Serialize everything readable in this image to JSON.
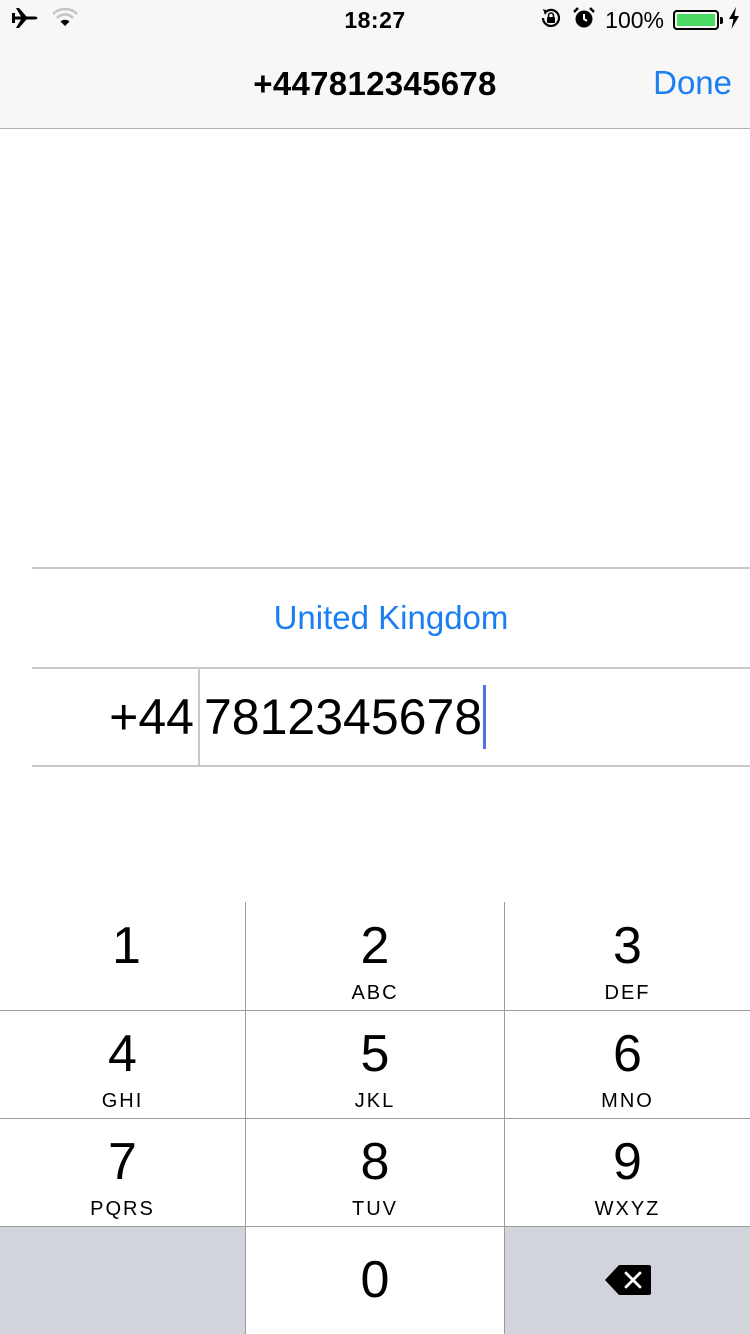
{
  "status_bar": {
    "time": "18:27",
    "battery_percent": "100%",
    "icons": [
      "airplane-icon",
      "wifi-icon",
      "rotation-lock-icon",
      "alarm-icon",
      "battery-icon",
      "charging-icon"
    ]
  },
  "nav": {
    "title": "+447812345678",
    "done_label": "Done"
  },
  "form": {
    "country": "United Kingdom",
    "dial_code": "+44",
    "phone_number": "7812345678"
  },
  "keypad": {
    "keys": [
      {
        "num": "1",
        "letters": ""
      },
      {
        "num": "2",
        "letters": "ABC"
      },
      {
        "num": "3",
        "letters": "DEF"
      },
      {
        "num": "4",
        "letters": "GHI"
      },
      {
        "num": "5",
        "letters": "JKL"
      },
      {
        "num": "6",
        "letters": "MNO"
      },
      {
        "num": "7",
        "letters": "PQRS"
      },
      {
        "num": "8",
        "letters": "TUV"
      },
      {
        "num": "9",
        "letters": "WXYZ"
      },
      {
        "num": "0",
        "letters": ""
      }
    ]
  },
  "colors": {
    "accent": "#1b7ff2",
    "battery_green": "#4cd964",
    "caret": "#5470e6",
    "key_gray": "#d1d5db"
  }
}
